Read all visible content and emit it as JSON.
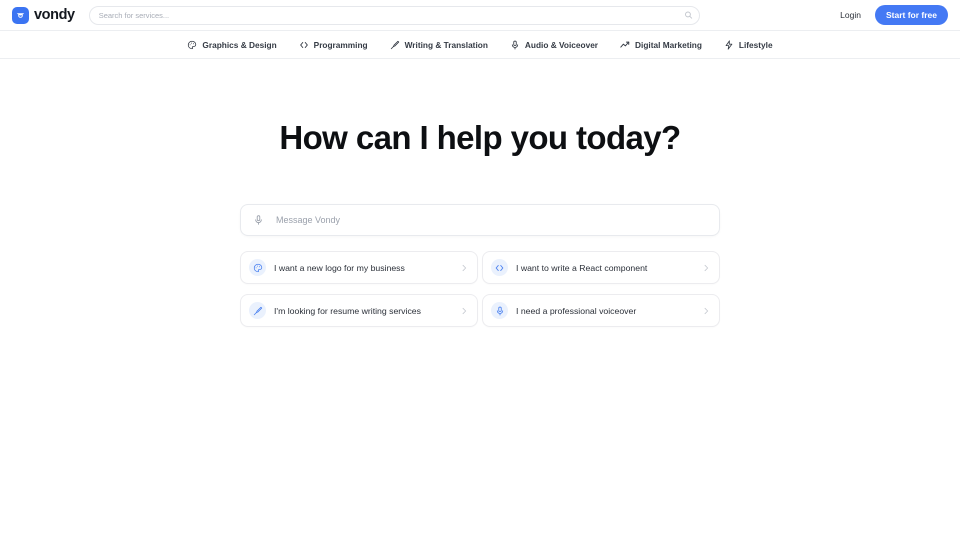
{
  "header": {
    "brand": {
      "name": "vondy",
      "logo_icon": "vondy-bird-logo-icon",
      "logo_color": "#3b74f2"
    },
    "search": {
      "value": "",
      "placeholder": "Search for services...",
      "icon": "search-icon"
    },
    "login_label": "Login",
    "cta_label": "Start for free",
    "cta_color": "#4479f4"
  },
  "nav": {
    "items": [
      {
        "label": "Graphics & Design",
        "icon": "palette-icon"
      },
      {
        "label": "Programming",
        "icon": "code-brackets-icon"
      },
      {
        "label": "Writing & Translation",
        "icon": "pen-nib-icon"
      },
      {
        "label": "Audio & Voiceover",
        "icon": "microphone-icon"
      },
      {
        "label": "Digital Marketing",
        "icon": "trending-up-icon"
      },
      {
        "label": "Lifestyle",
        "icon": "lightning-bolt-icon"
      }
    ]
  },
  "main": {
    "hero_title": "How can I help you today?",
    "composer": {
      "value": "",
      "placeholder": "Message Vondy",
      "mic_icon": "microphone-icon"
    },
    "suggestions": [
      {
        "label": "I want a new logo for my business",
        "icon": "palette-icon",
        "chevron": "chevron-right-icon"
      },
      {
        "label": "I want to write a React component",
        "icon": "code-brackets-icon",
        "chevron": "chevron-right-icon"
      },
      {
        "label": "I'm looking for resume writing services",
        "icon": "pen-nib-icon",
        "chevron": "chevron-right-icon"
      },
      {
        "label": "I need a professional voiceover",
        "icon": "microphone-icon",
        "chevron": "chevron-right-icon"
      }
    ],
    "accent_color": "#4c82f0",
    "badge_bg": "#eaf1fd"
  }
}
